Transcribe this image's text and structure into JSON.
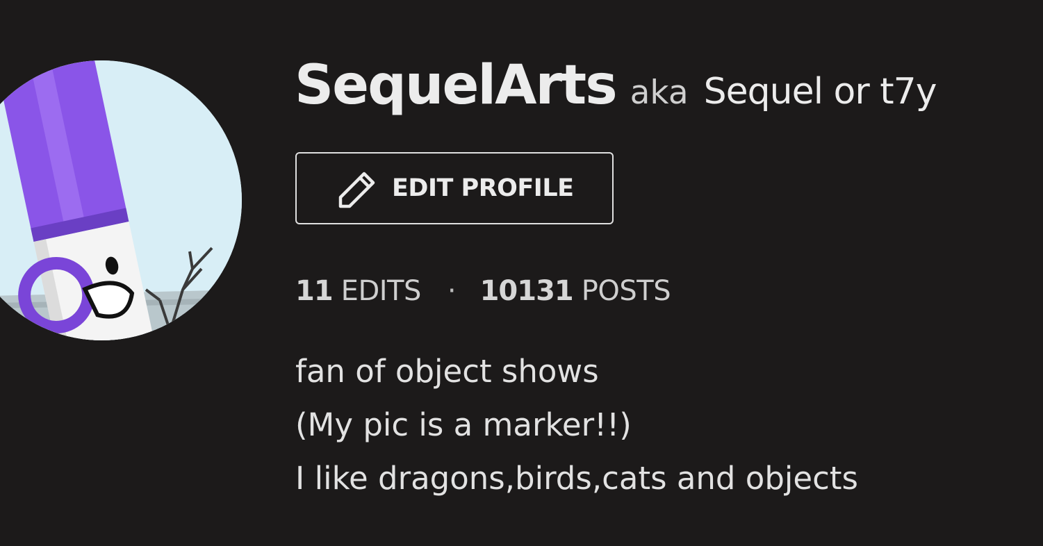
{
  "profile": {
    "username": "SequelArts",
    "aka_label": "aka",
    "alias": "Sequel or t7y",
    "avatar_icon": "marker-character-avatar",
    "edit_button": {
      "icon": "pencil-icon",
      "label": "EDIT PROFILE"
    },
    "stats": {
      "edits_count": "11",
      "edits_label": "EDITS",
      "separator": "·",
      "posts_count": "10131",
      "posts_label": "POSTS"
    },
    "bio": [
      "fan of object shows",
      "(My pic is a marker!!)",
      "I like dragons,birds,cats and objects"
    ]
  },
  "colors": {
    "background": "#1c1a1a",
    "text": "#ececec",
    "marker_purple": "#8a55e8",
    "avatar_sky": "#d8eef6"
  }
}
